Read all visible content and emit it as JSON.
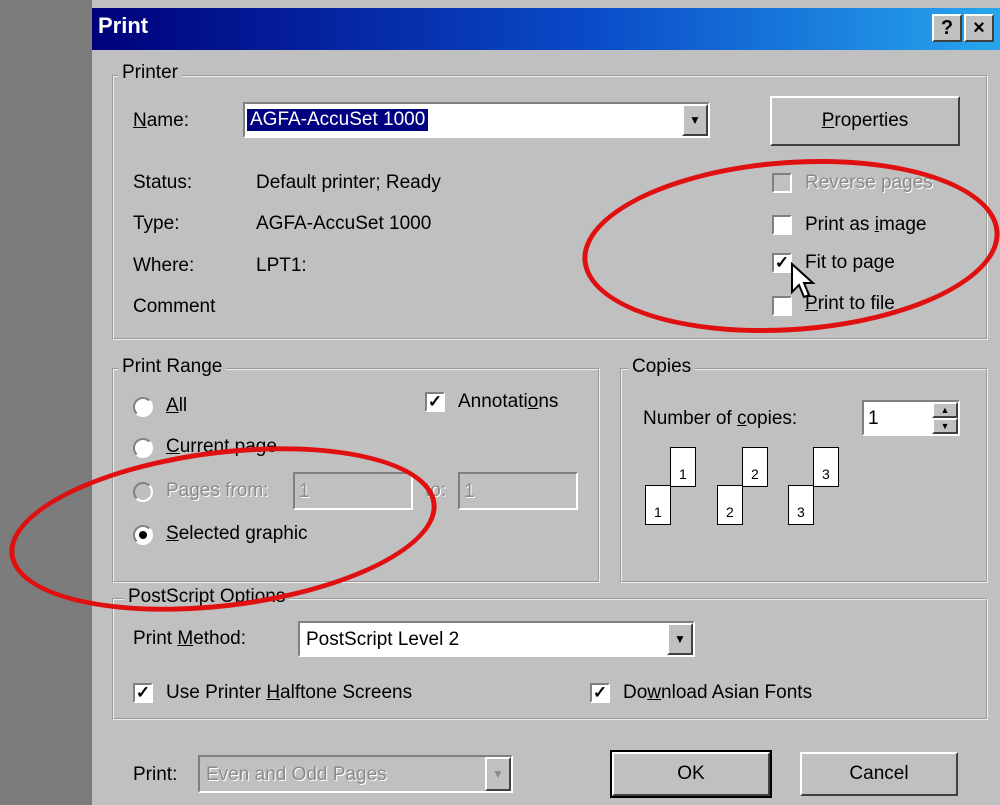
{
  "window": {
    "title": "Print",
    "help_label": "?",
    "close_label": "×"
  },
  "printer": {
    "legend": "Printer",
    "name_label": "Name:",
    "name_value": "AGFA-AccuSet 1000",
    "properties_label": "Properties",
    "status_label": "Status:",
    "status_value": "Default printer; Ready",
    "type_label": "Type:",
    "type_value": "AGFA-AccuSet 1000",
    "where_label": "Where:",
    "where_value": "LPT1:",
    "comment_label": "Comment",
    "options": [
      {
        "label": "Reverse pages",
        "checked": false,
        "enabled": false
      },
      {
        "label": "Print as image",
        "checked": false,
        "enabled": true
      },
      {
        "label": "Fit to page",
        "checked": true,
        "enabled": true
      },
      {
        "label": "Print to file",
        "checked": false,
        "enabled": true
      }
    ]
  },
  "print_range": {
    "legend": "Print Range",
    "all_label": "All",
    "current_page_label": "Current page",
    "pages_from_label": "Pages from:",
    "pages_from_value": "1",
    "to_label": "to:",
    "to_value": "1",
    "selected_graphic_label": "Selected graphic",
    "selected": "Selected graphic",
    "annotations_label": "Annotations",
    "annotations_checked": true
  },
  "copies": {
    "legend": "Copies",
    "number_label": "Number of copies:",
    "number_value": "1",
    "collate_pages": [
      "1",
      "1",
      "2",
      "2",
      "3",
      "3"
    ]
  },
  "postscript": {
    "legend": "PostScript Options",
    "method_label": "Print Method:",
    "method_value": "PostScript Level 2",
    "halftone_label": "Use Printer Halftone Screens",
    "halftone_checked": true,
    "asian_fonts_label": "Download Asian Fonts",
    "asian_fonts_checked": true
  },
  "footer": {
    "print_label": "Print:",
    "print_value": "Even and Odd Pages",
    "ok_label": "OK",
    "cancel_label": "Cancel"
  },
  "colors": {
    "title_start": "#00007b",
    "title_end": "#27a6ee",
    "annotation_ellipse": "#e01010",
    "dialog_face": "#c0c0c0"
  }
}
